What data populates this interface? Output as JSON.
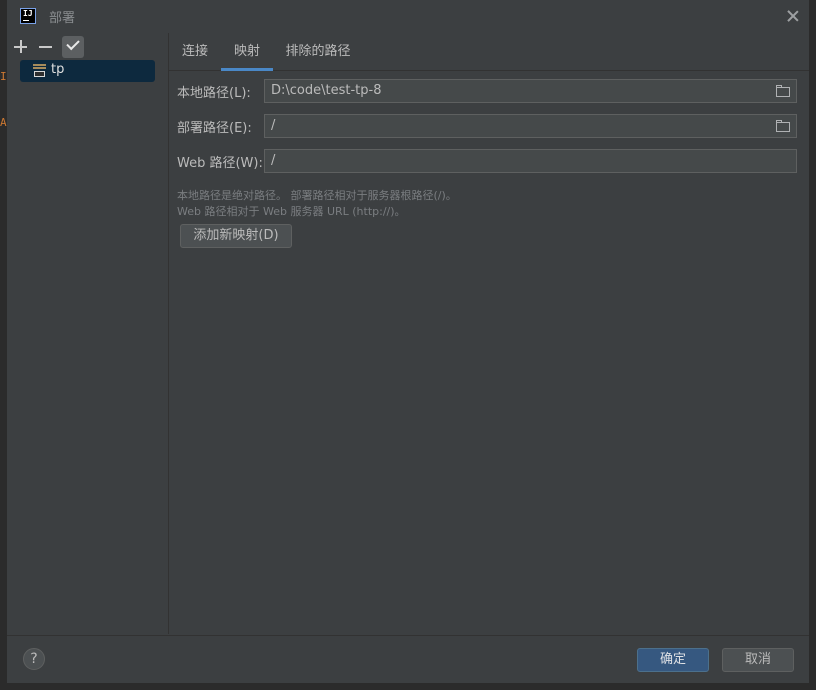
{
  "dialog": {
    "title": "部署"
  },
  "tree": {
    "items": [
      {
        "label": "tp"
      }
    ]
  },
  "tabs": [
    {
      "label": "连接"
    },
    {
      "label": "映射"
    },
    {
      "label": "排除的路径"
    }
  ],
  "mapping": {
    "local_path_label": "本地路径(L):",
    "local_path_value": "D:\\code\\test-tp-8",
    "deploy_path_label": "部署路径(E):",
    "deploy_path_value": "/",
    "web_path_label": "Web 路径(W):",
    "web_path_value": "/",
    "hint_line1": "本地路径是绝对路径。 部署路径相对于服务器根路径(/)。",
    "hint_line2": "Web 路径相对于 Web 服务器 URL (http://)。",
    "add_mapping_button": "添加新映射(D)"
  },
  "footer": {
    "help_label": "?",
    "ok_label": "确定",
    "cancel_label": "取消"
  },
  "colors": {
    "accent": "#4a88c7",
    "ok_button": "#365880",
    "selection": "#0d293e"
  }
}
